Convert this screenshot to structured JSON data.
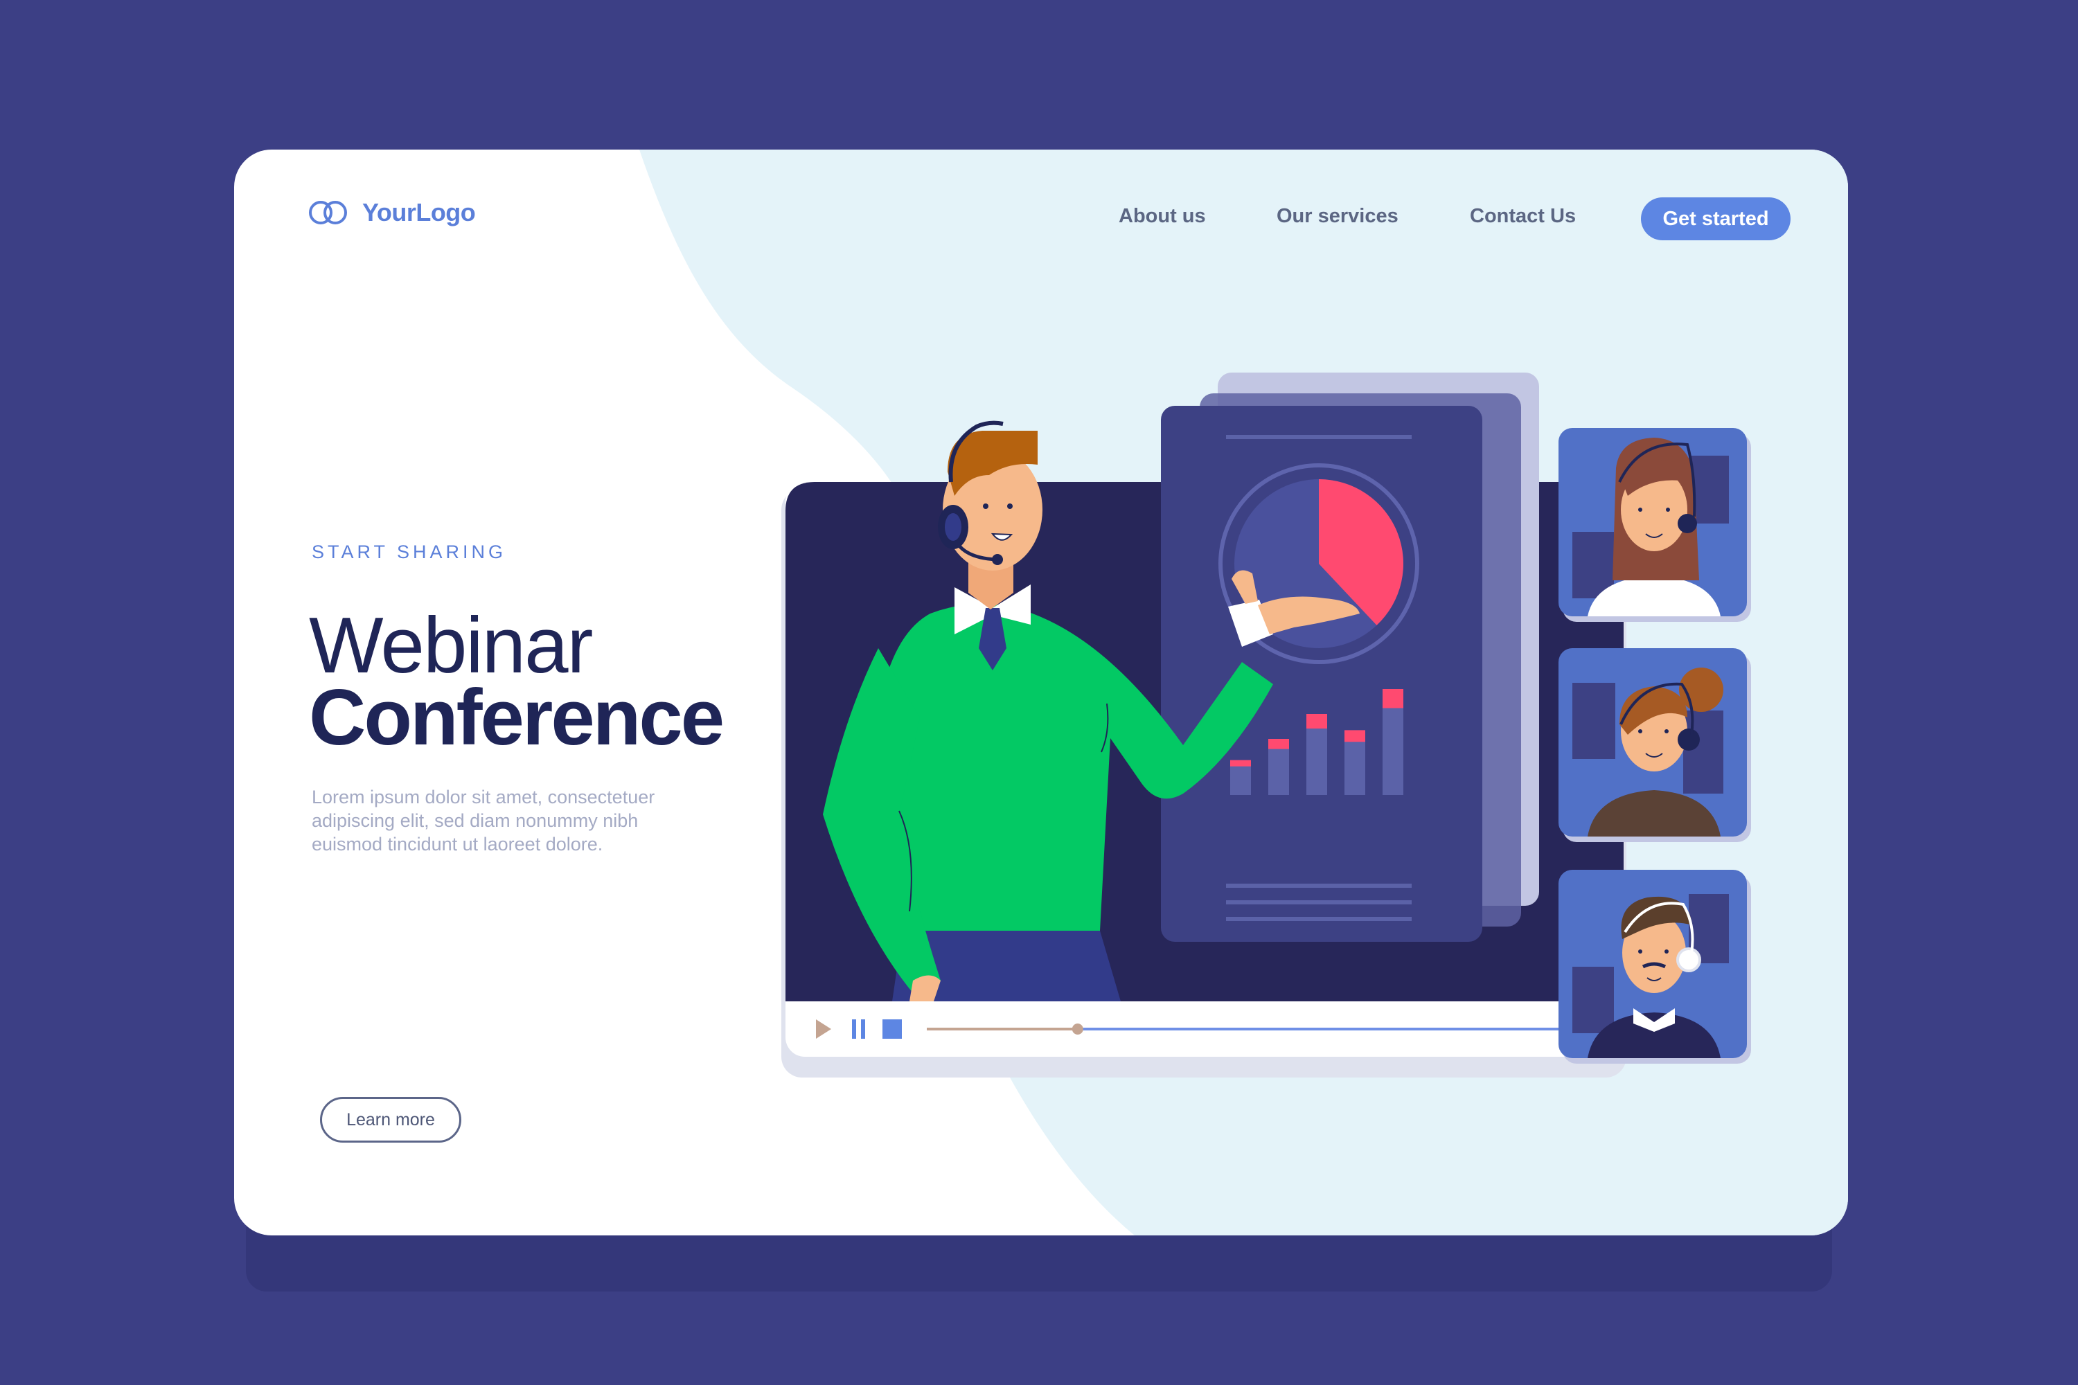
{
  "logo": {
    "icon": "two-rings-icon",
    "text": "YourLogo"
  },
  "nav": {
    "about": "About us",
    "services": "Our services",
    "contact": "Contact Us",
    "cta": "Get started"
  },
  "hero": {
    "eyebrow": "START SHARING",
    "title_line1": "Webinar",
    "title_line2": "Conference",
    "body": "Lorem ipsum dolor sit amet, consectetuer adipiscing elit, sed diam nonummy nibh euismod tincidunt ut laoreet dolore.",
    "cta": "Learn more"
  },
  "player": {
    "controls": [
      "play-icon",
      "pause-icon",
      "stop-icon"
    ],
    "progress": 0.22
  },
  "presentation": {
    "pie_fraction": 0.38,
    "bars": [
      0.28,
      0.45,
      0.65,
      0.52,
      0.85
    ]
  },
  "colors": {
    "page_bg": "#3c3f85",
    "accent": "#5d86e3",
    "title": "#1f2557",
    "sweater": "#03c964",
    "chart_pink": "#ff4a70",
    "screen_dark": "#272659",
    "slide": "#3d4184"
  }
}
